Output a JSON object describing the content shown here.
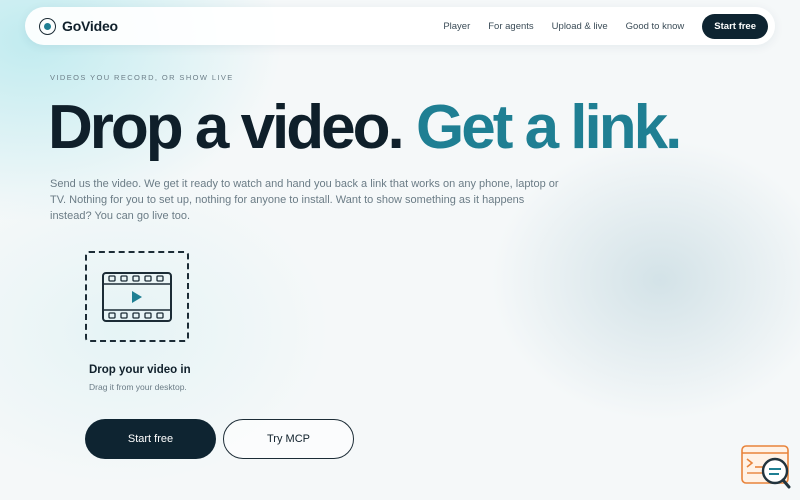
{
  "brand": {
    "name": "GoVideo"
  },
  "nav": {
    "links": [
      "Player",
      "For agents",
      "Upload & live",
      "Good to know"
    ],
    "cta": "Start free"
  },
  "hero": {
    "eyebrow": "VIDEOS YOU RECORD, OR SHOW LIVE",
    "headline_part1": "Drop a video.",
    "headline_part2": "Get a link.",
    "lede": "Send us the video. We get it ready to watch and hand you back a link that works on any phone, laptop or TV. Nothing for you to set up, nothing for anyone to install. Want to show something as it happens instead? You can go live too."
  },
  "dropzone": {
    "title": "Drop your video in",
    "subtitle": "Drag it from your desktop.",
    "icon": "film-play-icon"
  },
  "buttons": {
    "primary": "Start free",
    "secondary": "Try MCP"
  },
  "widget": {
    "icon": "search-console-icon"
  },
  "colors": {
    "accent": "#1f7f93",
    "dark": "#0e2431",
    "text_muted": "#6b7c86",
    "widget_orange": "#e8833a"
  }
}
